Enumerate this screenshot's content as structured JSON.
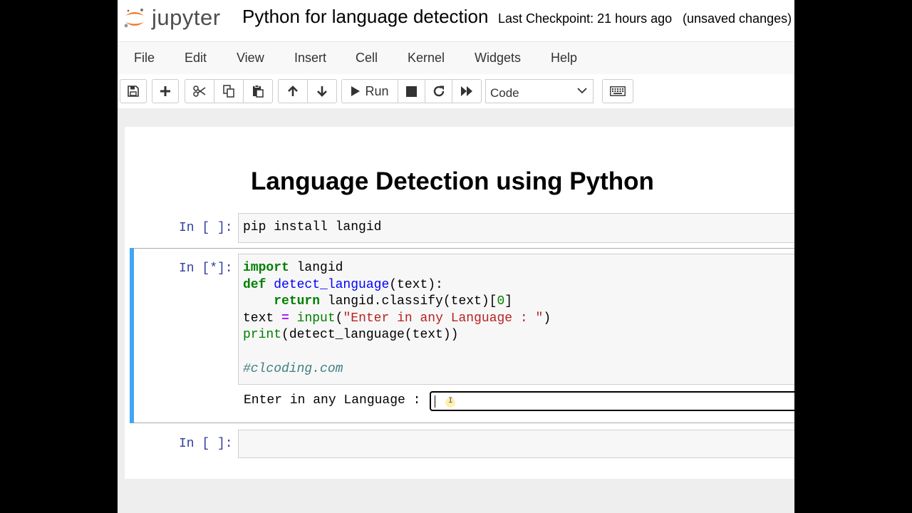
{
  "header": {
    "logo_text": "jupyter",
    "notebook_title": "Python for language detection",
    "checkpoint": "Last Checkpoint: 21 hours ago",
    "unsaved": "(unsaved changes)"
  },
  "menu": [
    "File",
    "Edit",
    "View",
    "Insert",
    "Cell",
    "Kernel",
    "Widgets",
    "Help"
  ],
  "toolbar": {
    "run_label": "Run",
    "cell_type": "Code",
    "icons": [
      "save-icon",
      "plus-icon",
      "cut-icon",
      "copy-icon",
      "paste-icon",
      "arrow-up-icon",
      "arrow-down-icon",
      "play-icon",
      "stop-icon",
      "restart-icon",
      "fast-forward-icon",
      "chevron-down-icon",
      "keyboard-icon"
    ]
  },
  "notebook": {
    "heading": "Language Detection using Python",
    "cells": [
      {
        "prompt": "In [ ]:",
        "code": "pip install langid"
      },
      {
        "prompt": "In [*]:",
        "code": "import langid\ndef detect_language(text):\n    return langid.classify(text)[0]\ntext = input(\"Enter in any Language : \")\nprint(detect_language(text))\n\n#clcoding.com"
      },
      {
        "prompt": "In [ ]:",
        "code": ""
      }
    ],
    "stdin_prompt": "Enter in any Language :",
    "stdin_value": ""
  },
  "colors": {
    "accent_blue": "#42a5f5",
    "prompt_blue": "#303f9f",
    "keyword_green": "#008000",
    "string_red": "#ba2121",
    "logo_orange": "#f37726"
  }
}
